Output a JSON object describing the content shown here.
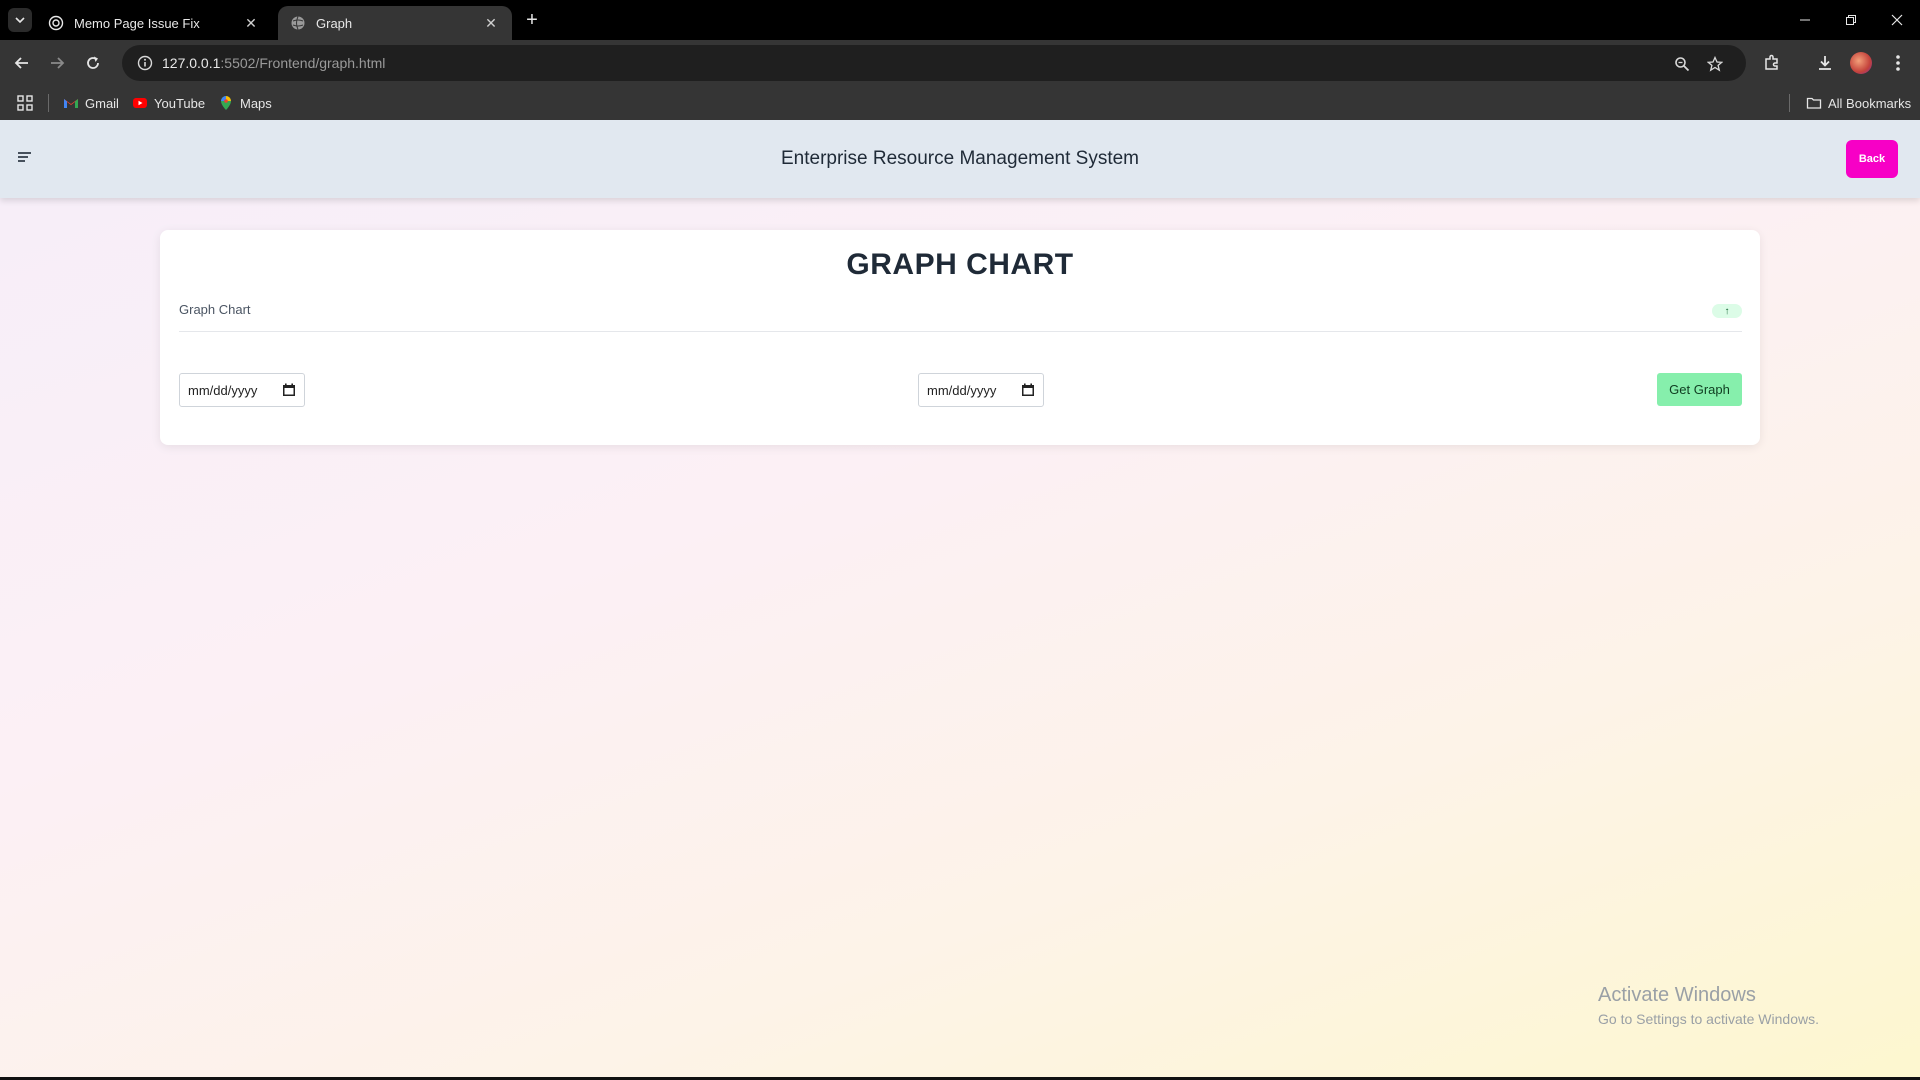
{
  "browser": {
    "tabs": [
      {
        "title": "Memo Page Issue Fix",
        "active": false
      },
      {
        "title": "Graph",
        "active": true
      }
    ],
    "url_host": "127.0.0.1",
    "url_rest": ":5502/Frontend/graph.html",
    "bookmarks": [
      "Gmail",
      "YouTube",
      "Maps"
    ],
    "all_bookmarks_label": "All Bookmarks"
  },
  "header": {
    "title": "Enterprise Resource Management System",
    "back_label": "Back",
    "back_color": "#f700c6"
  },
  "card": {
    "title": "GRAPH CHART",
    "subtitle": "Graph Chart",
    "trend_icon": "↑",
    "start_date_placeholder": "mm/dd/yyyy",
    "end_date_placeholder": "mm/dd/yyyy",
    "get_graph_label": "Get Graph",
    "get_graph_color": "#86efac"
  },
  "watermark": {
    "line1": "Activate Windows",
    "line2": "Go to Settings to activate Windows."
  }
}
